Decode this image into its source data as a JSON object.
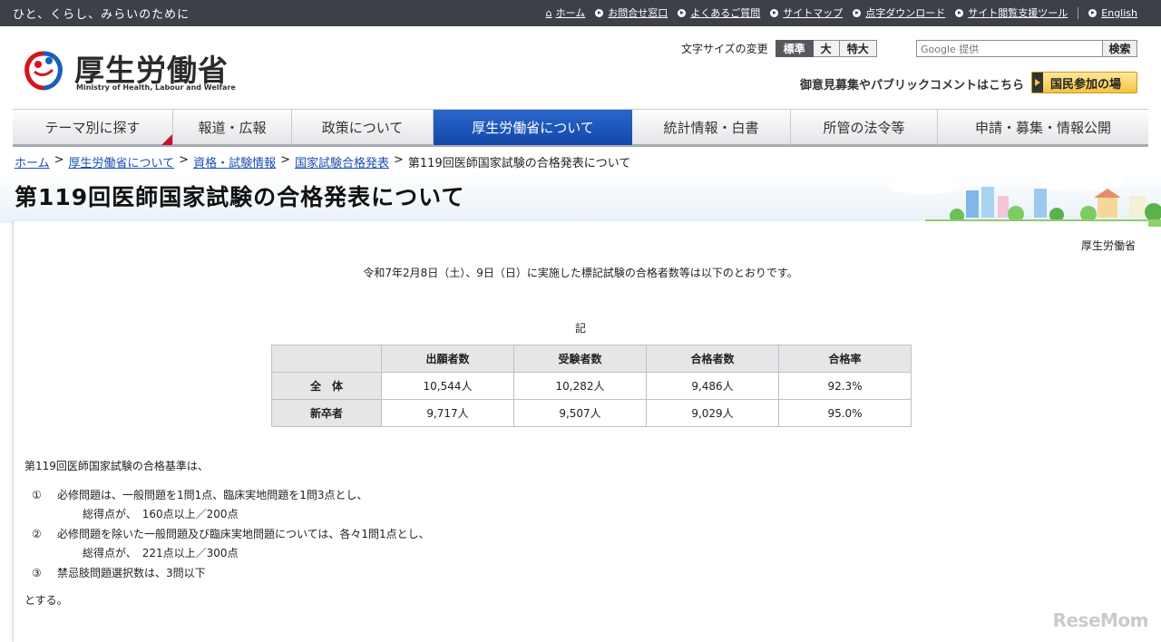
{
  "topbar": {
    "tagline": "ひと、くらし、みらいのために",
    "links": [
      "ホーム",
      "お問合せ窓口",
      "よくあるご質問",
      "サイトマップ",
      "点字ダウンロード",
      "サイト閲覧支援ツール"
    ],
    "english": "English"
  },
  "header": {
    "logo_ja": "厚生労働省",
    "logo_en": "Ministry of Health, Labour and Welfare",
    "fontsize_label": "文字サイズの変更",
    "fontsize_options": [
      "標準",
      "大",
      "特大"
    ],
    "search_placeholder": "Google 提供",
    "search_button": "検索",
    "opinion_text": "御意見募集やパブリックコメントはこちら",
    "participation_button": "国民参加の場"
  },
  "nav": {
    "items": [
      "テーマ別に探す",
      "報道・広報",
      "政策について",
      "厚生労働省について",
      "統計情報・白書",
      "所管の法令等",
      "申請・募集・情報公開"
    ]
  },
  "breadcrumb": {
    "items": [
      "ホーム",
      "厚生労働省について",
      "資格・試験情報",
      "国家試験合格発表"
    ],
    "current": "第119回医師国家試験の合格発表について"
  },
  "page": {
    "title": "第119回医師国家試験の合格発表について",
    "author": "厚生労働省",
    "intro": "令和7年2月8日（土）、9日（日）に実施した標記試験の合格者数等は以下のとおりです。",
    "ki": "記"
  },
  "table": {
    "headers": [
      "出願者数",
      "受験者数",
      "合格者数",
      "合格率"
    ],
    "rows": [
      {
        "label": "全　体",
        "cells": [
          "10,544人",
          "10,282人",
          "9,486人",
          "92.3%"
        ]
      },
      {
        "label": "新卒者",
        "cells": [
          "9,717人",
          "9,507人",
          "9,029人",
          "95.0%"
        ]
      }
    ]
  },
  "criteria": {
    "intro": "第119回医師国家試験の合格基準は、",
    "items": [
      {
        "num": "①",
        "text": "必修問題は、一般問題を1問1点、臨床実地問題を1問3点とし、",
        "sub": "総得点が、　160点以上／200点"
      },
      {
        "num": "②",
        "text": "必修問題を除いた一般問題及び臨床実地問題については、各々1問1点とし、",
        "sub": "総得点が、　221点以上／300点"
      },
      {
        "num": "③",
        "text": "禁忌肢問題選択数は、3問以下",
        "sub": ""
      }
    ],
    "closing": "とする。"
  },
  "watermark": "ReseMom"
}
